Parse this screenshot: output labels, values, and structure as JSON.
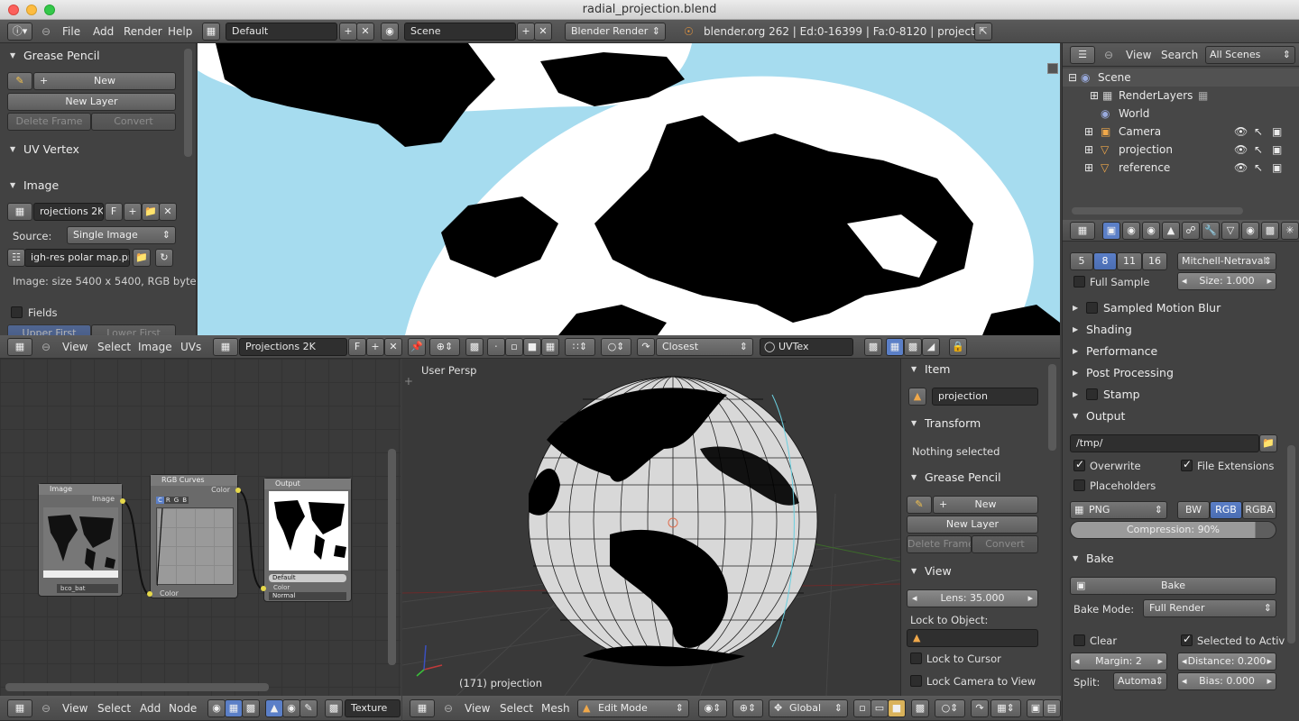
{
  "window": {
    "title": "radial_projection.blend"
  },
  "info_header": {
    "menus": [
      "File",
      "Add",
      "Render",
      "Help"
    ],
    "layout": "Default",
    "scene": "Scene",
    "engine": "Blender Render",
    "stats": "blender.org 262 | Ed:0-16399 | Fa:0-8120 | projection"
  },
  "image_sidebar": {
    "grease_pencil": {
      "title": "Grease Pencil",
      "new_label": "New",
      "new_layer": "New Layer",
      "delete_frame": "Delete Frame",
      "convert": "Convert"
    },
    "uv_vertex": {
      "title": "UV Vertex"
    },
    "image": {
      "title": "Image",
      "name": "rojections 2K",
      "f_label": "F",
      "source_label": "Source:",
      "source_value": "Single Image",
      "filepath": "igh-res polar map.png",
      "info": "Image: size 5400 x 5400, RGB byte"
    },
    "fields": {
      "label": "Fields",
      "upper": "Upper First",
      "lower": "Lower First"
    }
  },
  "image_header": {
    "menus": [
      "View",
      "Select",
      "Image",
      "UVs"
    ],
    "image_name": "Projections 2K",
    "f_label": "F",
    "sampling": "Closest",
    "uv_map": "UVTex"
  },
  "outliner": {
    "menus": [
      "View",
      "Search"
    ],
    "filter": "All Scenes",
    "items": [
      {
        "label": "Scene"
      },
      {
        "label": "RenderLayers"
      },
      {
        "label": "World"
      },
      {
        "label": "Camera"
      },
      {
        "label": "projection"
      },
      {
        "label": "reference"
      }
    ]
  },
  "properties": {
    "aa_samples": [
      "5",
      "8",
      "11",
      "16"
    ],
    "aa_filter": "Mitchell-Netraval",
    "full_sample": "Full Sample",
    "size": "Size: 1.000",
    "sampled_motion_blur": "Sampled Motion Blur",
    "shading": "Shading",
    "performance": "Performance",
    "post_processing": "Post Processing",
    "stamp": "Stamp",
    "output": {
      "title": "Output",
      "path": "/tmp/",
      "overwrite": "Overwrite",
      "file_extensions": "File Extensions",
      "placeholders": "Placeholders",
      "format": "PNG",
      "bw": "BW",
      "rgb": "RGB",
      "rgba": "RGBA",
      "compression": "Compression: 90%"
    },
    "bake": {
      "title": "Bake",
      "bake_button": "Bake",
      "mode_label": "Bake Mode:",
      "mode_value": "Full Render",
      "clear": "Clear",
      "selected_to_active": "Selected to Activ",
      "margin": "Margin: 2",
      "distance": "Distance: 0.200",
      "split_label": "Split:",
      "split_value": "Automa",
      "bias": "Bias: 0.000"
    }
  },
  "node_editor": {
    "nodes": {
      "image": {
        "title": "Image",
        "socket": "Image",
        "name": "bco_bat",
        "f": "F"
      },
      "curves": {
        "title": "RGB Curves",
        "socket_out": "Color",
        "socket_in": "Color",
        "tabs": [
          "C",
          "R",
          "G",
          "B"
        ]
      },
      "output": {
        "title": "Output",
        "field": "Default",
        "socket": "Color",
        "blend": "Normal"
      }
    },
    "header": {
      "menus": [
        "View",
        "Select",
        "Add",
        "Node"
      ],
      "texture": "Texture"
    }
  },
  "viewport": {
    "label": "User Persp",
    "object_label": "(171) projection",
    "header": {
      "menus": [
        "View",
        "Select",
        "Mesh"
      ],
      "mode": "Edit Mode",
      "orientation": "Global"
    }
  },
  "view3d_sidebar": {
    "item": {
      "title": "Item",
      "name": "projection"
    },
    "transform": {
      "title": "Transform",
      "text": "Nothing selected"
    },
    "grease_pencil": {
      "title": "Grease Pencil",
      "new_label": "New",
      "new_layer": "New Layer",
      "delete_frame": "Delete Frame",
      "convert": "Convert"
    },
    "view": {
      "title": "View",
      "lens": "Lens: 35.000",
      "lock_object": "Lock to Object:",
      "lock_cursor": "Lock to Cursor",
      "lock_camera": "Lock Camera to View"
    }
  }
}
